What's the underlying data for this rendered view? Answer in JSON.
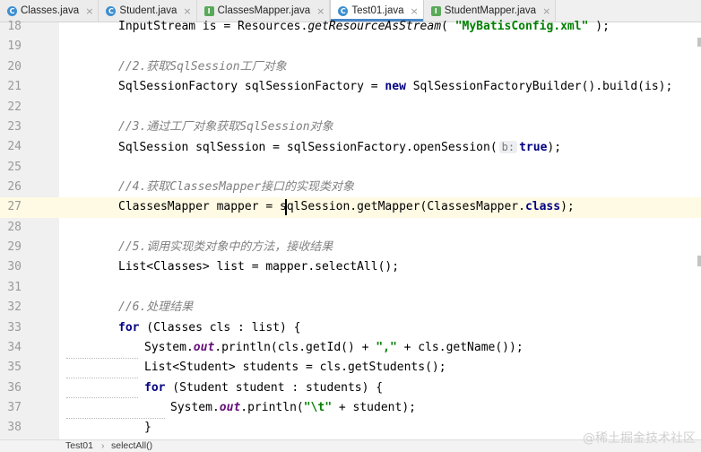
{
  "tabs": [
    {
      "label": "Classes.java",
      "icon": "class-icon"
    },
    {
      "label": "Student.java",
      "icon": "class-icon"
    },
    {
      "label": "ClassesMapper.java",
      "icon": "interface-icon"
    },
    {
      "label": "Test01.java",
      "icon": "class-icon",
      "active": true
    },
    {
      "label": "StudentMapper.java",
      "icon": "interface-icon"
    }
  ],
  "tab_close_glyph": "×",
  "code": {
    "line_numbers": [
      "18",
      "19",
      "20",
      "21",
      "22",
      "23",
      "24",
      "25",
      "26",
      "27",
      "28",
      "29",
      "30",
      "31",
      "32",
      "33",
      "34",
      "35",
      "36",
      "37",
      "38"
    ],
    "current_line": "27",
    "l18_a": "InputStream is = Resources.",
    "l18_m": "getResourceAsStream",
    "l18_b": "( ",
    "l18_str": "\"MyBatisConfig.xml\"",
    "l18_c": " );",
    "l20_cmt": "//2.获取SqlSession工厂对象",
    "l21_a": "SqlSessionFactory sqlSessionFactory = ",
    "l21_kw": "new",
    "l21_b": " SqlSessionFactoryBuilder().build(is);",
    "l23_cmt": "//3.通过工厂对象获取SqlSession对象",
    "l24_a": "SqlSession sqlSession = sqlSessionFactory.openSession(",
    "l24_hint": "b:",
    "l24_kw": "true",
    "l24_b": ");",
    "l26_cmt": "//4.获取ClassesMapper接口的实现类对象",
    "l27_a": "ClassesMapper mapper = sqlSession.getMapper(ClassesMapper.",
    "l27_kw": "class",
    "l27_b": ");",
    "l29_cmt": "//5.调用实现类对象中的方法，接收结果",
    "l30": "List<Classes> list = mapper.selectAll();",
    "l32_cmt": "//6.处理结果",
    "l33_kw": "for",
    "l33_b": " (Classes cls : list) {",
    "l34_a": "System.",
    "l34_fld": "out",
    "l34_b": ".println(cls.getId() + ",
    "l34_str": "\",\"",
    "l34_c": " + cls.getName());",
    "l35": "List<Student> students = cls.getStudents();",
    "l36_kw": "for",
    "l36_b": " (Student student : students) {",
    "l37_a": "System.",
    "l37_fld": "out",
    "l37_b": ".println(",
    "l37_str": "\"\\t\"",
    "l37_c": " + student);",
    "l38": "}"
  },
  "breadcrumb": [
    "Test01",
    "selectAll()"
  ],
  "breadcrumb_sep": "›",
  "watermark": "@稀土掘金技术社区",
  "colors": {
    "keyword": "#000080",
    "comment": "#808080",
    "string": "#008000",
    "field": "#660e7a",
    "current_line": "#fffae3",
    "active_tab_underline": "#4a88c7"
  }
}
